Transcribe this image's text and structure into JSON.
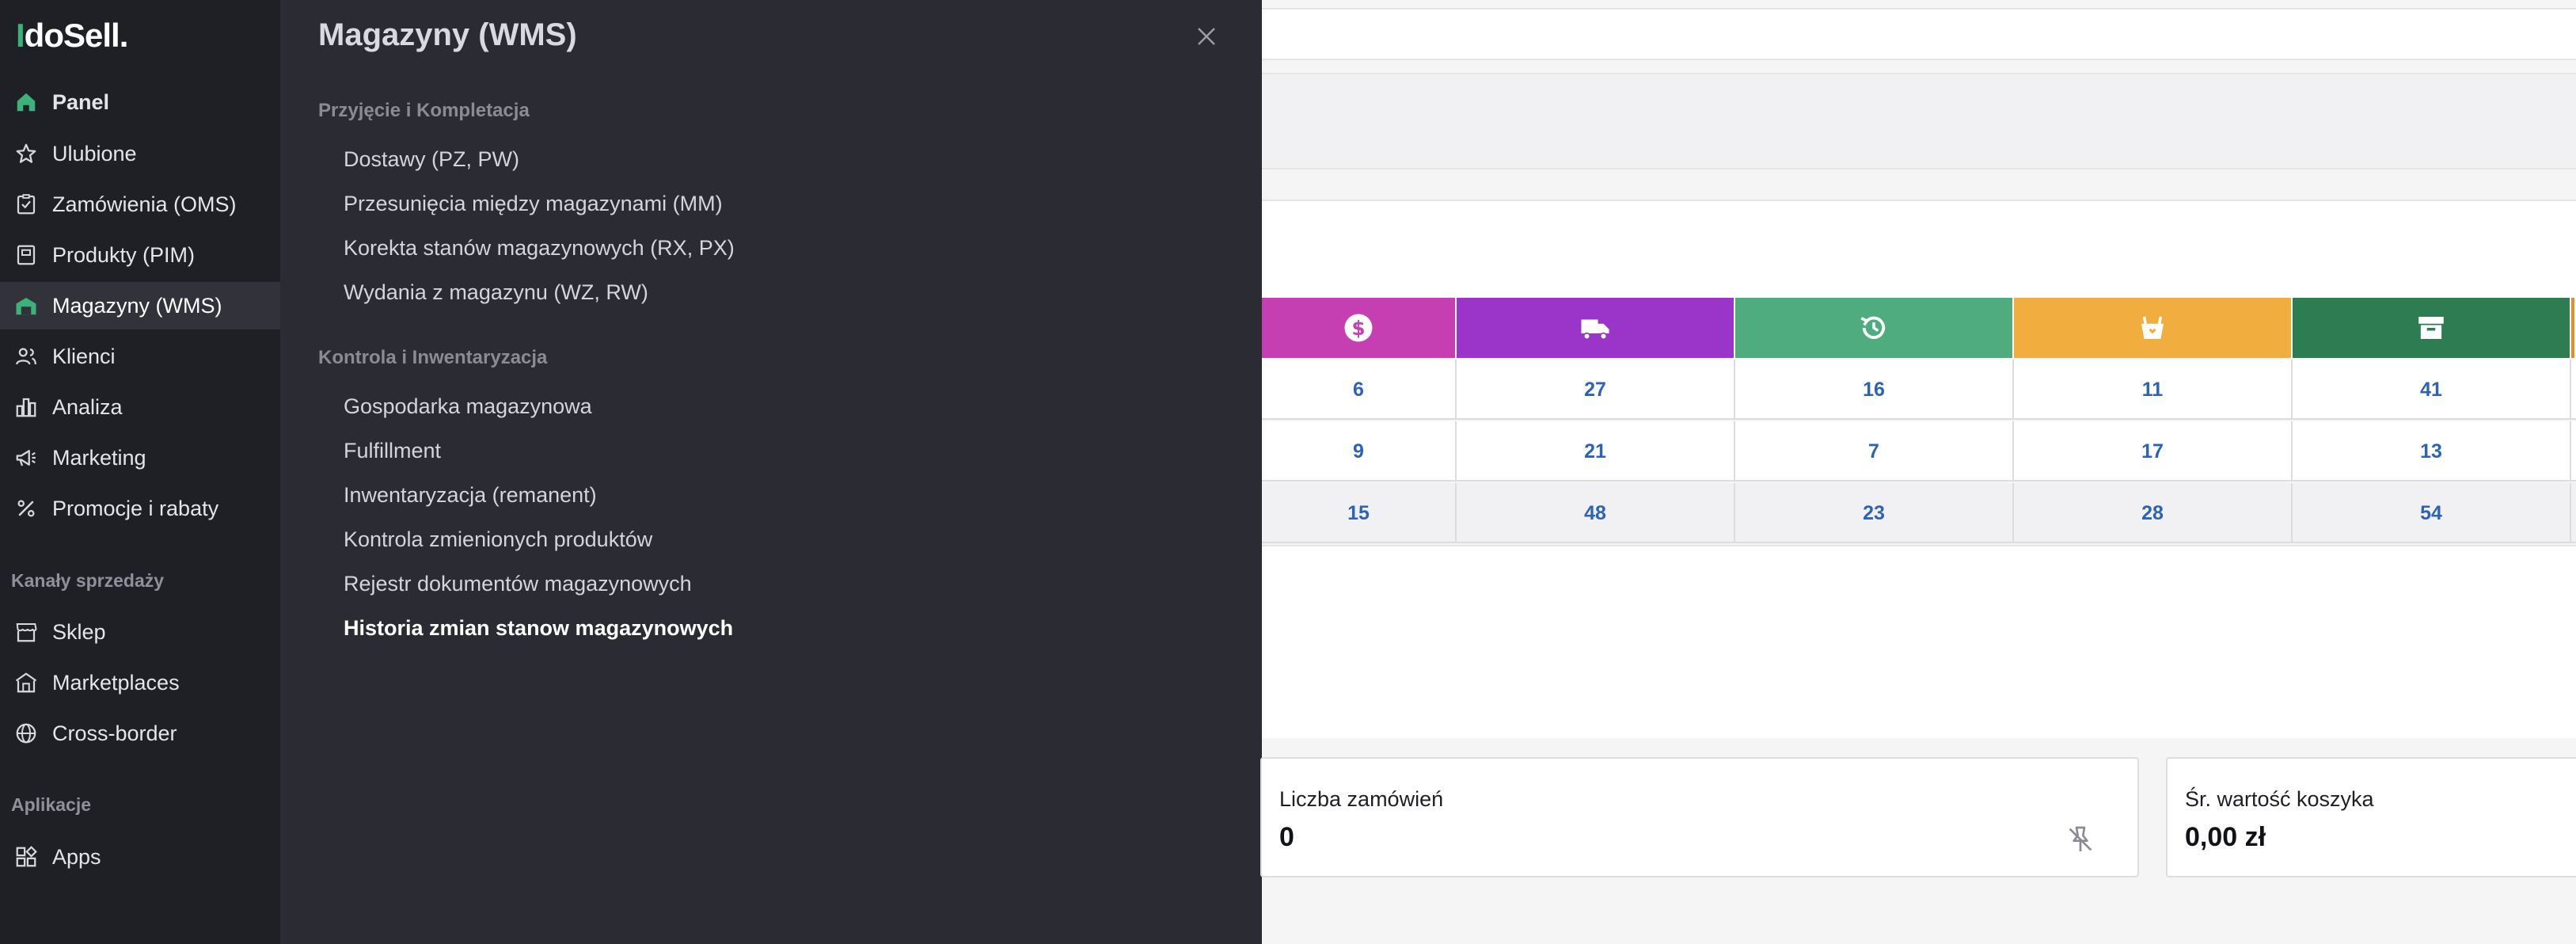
{
  "sidebar": {
    "logo_prefix": "I",
    "logo_text": "doSell.",
    "items": [
      {
        "label": "Panel"
      },
      {
        "label": "Ulubione"
      },
      {
        "label": "Zamówienia (OMS)"
      },
      {
        "label": "Produkty (PIM)"
      },
      {
        "label": "Magazyny (WMS)"
      },
      {
        "label": "Klienci"
      },
      {
        "label": "Analiza"
      },
      {
        "label": "Marketing"
      },
      {
        "label": "Promocje i rabaty"
      }
    ],
    "channels_label": "Kanały sprzedaży",
    "channels": [
      {
        "label": "Sklep"
      },
      {
        "label": "Marketplaces"
      },
      {
        "label": "Cross-border"
      }
    ],
    "apps_label": "Aplikacje",
    "apps": [
      {
        "label": "Apps"
      }
    ]
  },
  "flyout": {
    "title": "Magazyny (WMS)",
    "groups": [
      {
        "label": "Przyjęcie i Kompletacja",
        "links": [
          "Dostawy (PZ, PW)",
          "Przesunięcia między magazynami (MM)",
          "Korekta stanów magazynowych (RX, PX)",
          "Wydania z magazynu (WZ, RW)"
        ]
      },
      {
        "label": "Kontrola i Inwentaryzacja",
        "links": [
          "Gospodarka magazynowa",
          "Fulfillment",
          "Inwentaryzacja (remanent)",
          "Kontrola zmienionych produktów",
          "Rejestr dokumentów magazynowych",
          "Historia zmian stanow magazynowych"
        ]
      }
    ]
  },
  "dashboard": {
    "tiles": [
      {
        "icon": "dollar-icon",
        "color": "#c53fb3"
      },
      {
        "icon": "truck-icon",
        "color": "#9b35c9"
      },
      {
        "icon": "history-icon",
        "color": "#4fac7f"
      },
      {
        "icon": "basket-icon",
        "color": "#f1ae3f"
      },
      {
        "icon": "archive-icon",
        "color": "#2e7c52"
      }
    ],
    "rows": [
      [
        "6",
        "27",
        "16",
        "11",
        "41"
      ],
      [
        "9",
        "21",
        "7",
        "17",
        "13"
      ],
      [
        "15",
        "48",
        "23",
        "28",
        "54"
      ]
    ],
    "cards": [
      {
        "label": "Liczba zamówień",
        "value": "0"
      },
      {
        "label": "Śr. wartość koszyka",
        "value": "0,00 zł"
      }
    ]
  }
}
